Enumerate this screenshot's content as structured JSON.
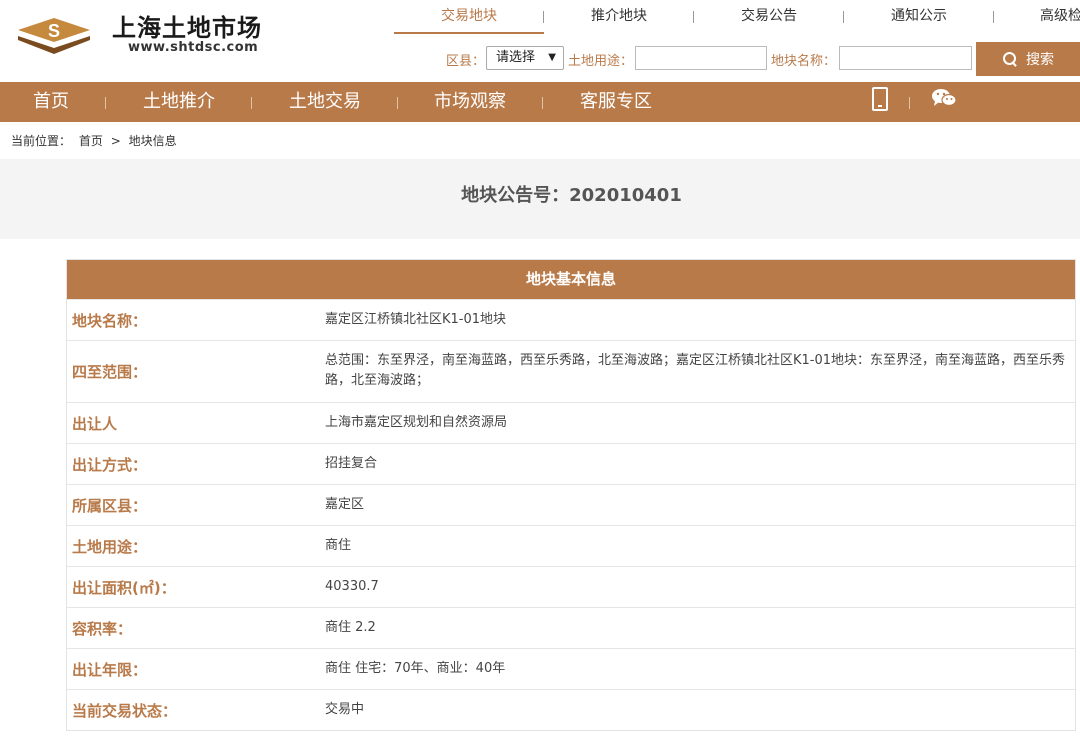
{
  "header": {
    "site_name": "上海土地市场",
    "site_url": "www.shtdsc.com",
    "top_nav": [
      {
        "label": "交易地块",
        "active": true
      },
      {
        "label": "推介地块",
        "active": false
      },
      {
        "label": "交易公告",
        "active": false
      },
      {
        "label": "通知公示",
        "active": false
      },
      {
        "label": "高级检",
        "active": false
      }
    ],
    "search": {
      "district_label": "区县：",
      "district_value": "请选择",
      "landuse_label": "土地用途：",
      "landuse_value": "",
      "plotname_label": "地块名称：",
      "plotname_value": "",
      "button_label": "搜索"
    }
  },
  "main_nav": [
    "首页",
    "土地推介",
    "土地交易",
    "市场观察",
    "客服专区"
  ],
  "breadcrumb": {
    "prefix": "当前位置：",
    "home": "首页",
    "separator": ">",
    "current": "地块信息"
  },
  "notice": {
    "title": "地块公告号：202010401"
  },
  "info_table": {
    "title": "地块基本信息",
    "rows": [
      {
        "label": "地块名称：",
        "value": "嘉定区江桥镇北社区K1-01地块"
      },
      {
        "label": "四至范围：",
        "value": "总范围：东至界泾，南至海蓝路，西至乐秀路，北至海波路；嘉定区江桥镇北社区K1-01地块：东至界泾，南至海蓝路，西至乐秀路，北至海波路；"
      },
      {
        "label": "出让人",
        "value": "上海市嘉定区规划和自然资源局"
      },
      {
        "label": "出让方式：",
        "value": "招挂复合"
      },
      {
        "label": "所属区县：",
        "value": "嘉定区"
      },
      {
        "label": "土地用途：",
        "value": "商住"
      },
      {
        "label": "出让面积(㎡)：",
        "value": "40330.7"
      },
      {
        "label": "容积率：",
        "value": "商住 2.2"
      },
      {
        "label": "出让年限：",
        "value": "商住 住宅：70年、商业：40年"
      },
      {
        "label": "当前交易状态：",
        "value": "交易中"
      }
    ]
  },
  "colors": {
    "accent": "#b97a4a",
    "band": "#f4f4f4"
  },
  "icons": [
    "logo-icon",
    "search-icon",
    "phone-icon",
    "wechat-icon",
    "caret-down-icon"
  ]
}
